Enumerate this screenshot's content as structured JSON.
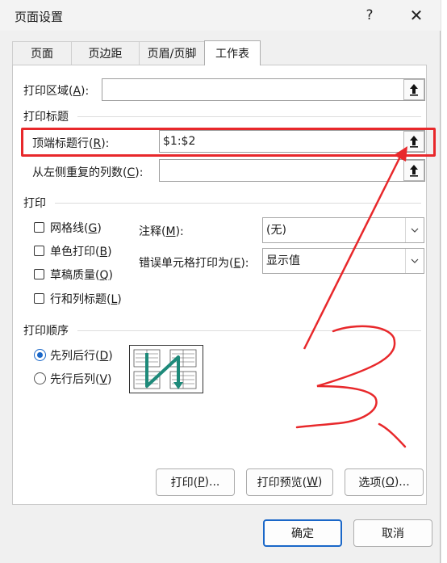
{
  "dialog": {
    "title": "页面设置",
    "help_icon": "?",
    "close_icon": "✕"
  },
  "tabs": [
    {
      "label": "页面",
      "active": false
    },
    {
      "label": "页边距",
      "active": false
    },
    {
      "label": "页眉/页脚",
      "active": false
    },
    {
      "label": "工作表",
      "active": true
    }
  ],
  "print_area": {
    "label": "打印区域(",
    "key": "A",
    "suffix": "):",
    "value": ""
  },
  "print_titles": {
    "group": "打印标题",
    "rows": {
      "label": "顶端标题行(",
      "key": "R",
      "suffix": "):",
      "value": "$1:$2"
    },
    "cols": {
      "label": "从左侧重复的列数(",
      "key": "C",
      "suffix": "):",
      "value": ""
    }
  },
  "print": {
    "group": "打印",
    "gridlines": {
      "label": "网格线(",
      "key": "G",
      "suffix": ")",
      "checked": false
    },
    "mono": {
      "label": "单色打印(",
      "key": "B",
      "suffix": ")",
      "checked": false
    },
    "draft": {
      "label": "草稿质量(",
      "key": "Q",
      "suffix": ")",
      "checked": false
    },
    "headings": {
      "label": "行和列标题(",
      "key": "L",
      "suffix": ")",
      "checked": false
    },
    "comments": {
      "label": "注释(",
      "key": "M",
      "suffix": "):",
      "value": "(无)"
    },
    "errors": {
      "label": "错误单元格打印为(",
      "key": "E",
      "suffix": "):",
      "value": "显示值"
    }
  },
  "order": {
    "group": "打印顺序",
    "down_then_over": {
      "label": "先列后行(",
      "key": "D",
      "suffix": ")",
      "selected": true
    },
    "over_then_down": {
      "label": "先行后列(",
      "key": "V",
      "suffix": ")",
      "selected": false
    }
  },
  "buttons": {
    "print": {
      "label": "打印(",
      "key": "P",
      "suffix": ")..."
    },
    "preview": {
      "label": "打印预览(",
      "key": "W",
      "suffix": ")"
    },
    "options": {
      "label": "选项(",
      "key": "O",
      "suffix": ")..."
    },
    "ok": "确定",
    "cancel": "取消"
  },
  "colors": {
    "accent": "#1a67c8",
    "annotation": "#e8282b",
    "order_arrow": "#1e8a7a"
  },
  "icons": [
    "help-icon",
    "close-icon",
    "collapse-dialog-icon",
    "chevron-down-icon",
    "page-order-icon"
  ]
}
